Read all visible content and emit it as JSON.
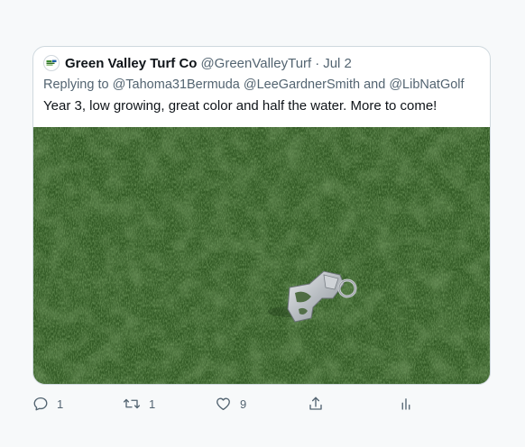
{
  "tweet": {
    "display_name": "Green Valley Turf Co",
    "handle": "@GreenValleyTurf",
    "separator": "·",
    "date": "Jul 2",
    "reply_prefix": "Replying to",
    "reply_mentions": [
      "@Tahoma31Bermuda",
      "@LeeGardnerSmith"
    ],
    "reply_and": "and",
    "reply_last_mention": "@LibNatGolf",
    "text": "Year 3, low growing, great color and half the water. More to come!",
    "media": {
      "description_icon": "grass-photo-with-bottle-opener-keychain",
      "colors": {
        "grass_dark": "#2f5a22",
        "grass_mid": "#3f7030",
        "grass_light": "#5c8a45"
      }
    }
  },
  "actions": {
    "reply": {
      "icon": "reply-icon",
      "count": "1"
    },
    "retweet": {
      "icon": "retweet-icon",
      "count": "1"
    },
    "like": {
      "icon": "heart-icon",
      "count": "9"
    },
    "share": {
      "icon": "share-icon"
    },
    "analytics": {
      "icon": "analytics-icon"
    }
  },
  "colors": {
    "page_bg": "#f7f9fa",
    "card_border": "#cfd9de",
    "text_primary": "#0f1419",
    "text_secondary": "#536471"
  }
}
